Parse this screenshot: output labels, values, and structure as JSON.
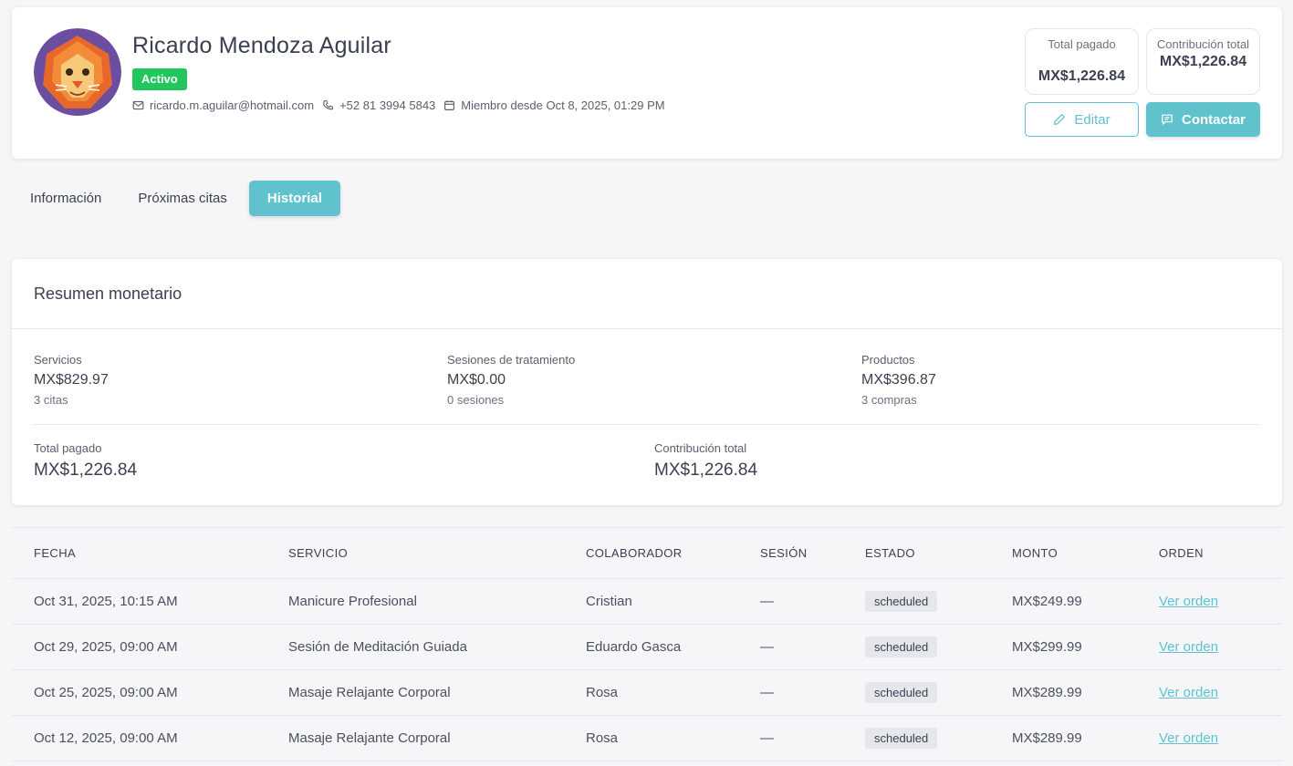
{
  "profile": {
    "name": "Ricardo Mendoza Aguilar",
    "status": "Activo",
    "email": "ricardo.m.aguilar@hotmail.com",
    "phone": "+52 81 3994 5843",
    "member_since": "Miembro desde Oct 8, 2025, 01:29 PM",
    "avatar": "lion-avatar",
    "stats": [
      {
        "label": "Total pagado",
        "value": "MX$1,226.84"
      },
      {
        "label": "Contribución total",
        "value": "MX$1,226.84"
      }
    ],
    "edit_label": "Editar",
    "contact_label": "Contactar"
  },
  "tabs": [
    {
      "label": "Información"
    },
    {
      "label": "Próximas citas"
    },
    {
      "label": "Historial"
    }
  ],
  "summary": {
    "title": "Resumen monetario",
    "metrics": [
      {
        "label": "Servicios",
        "value": "MX$829.97",
        "sub": "3 citas"
      },
      {
        "label": "Sesiones de tratamiento",
        "value": "MX$0.00",
        "sub": "0 sesiones"
      },
      {
        "label": "Productos",
        "value": "MX$396.87",
        "sub": "3 compras"
      }
    ],
    "totals": [
      {
        "label": "Total pagado",
        "value": "MX$1,226.84"
      },
      {
        "label": "Contribución total",
        "value": "MX$1,226.84"
      }
    ]
  },
  "table": {
    "headers": [
      "FECHA",
      "SERVICIO",
      "COLABORADOR",
      "SESIÓN",
      "ESTADO",
      "MONTO",
      "ORDEN"
    ],
    "rows": [
      {
        "fecha": "Oct 31, 2025, 10:15 AM",
        "servicio": "Manicure Profesional",
        "colaborador": "Cristian",
        "sesion": "—",
        "estado": "scheduled",
        "monto": "MX$249.99",
        "orden": "Ver orden"
      },
      {
        "fecha": "Oct 29, 2025, 09:00 AM",
        "servicio": "Sesión de Meditación Guiada",
        "colaborador": "Eduardo Gasca",
        "sesion": "—",
        "estado": "scheduled",
        "monto": "MX$299.99",
        "orden": "Ver orden"
      },
      {
        "fecha": "Oct 25, 2025, 09:00 AM",
        "servicio": "Masaje Relajante Corporal",
        "colaborador": "Rosa",
        "sesion": "—",
        "estado": "scheduled",
        "monto": "MX$289.99",
        "orden": "Ver orden"
      },
      {
        "fecha": "Oct 12, 2025, 09:00 AM",
        "servicio": "Masaje Relajante Corporal",
        "colaborador": "Rosa",
        "sesion": "—",
        "estado": "scheduled",
        "monto": "MX$289.99",
        "orden": "Ver orden"
      }
    ]
  },
  "colors": {
    "accent": "#5fc2cc",
    "active_badge": "#22c55e",
    "page_bg": "#f6f6f8"
  }
}
